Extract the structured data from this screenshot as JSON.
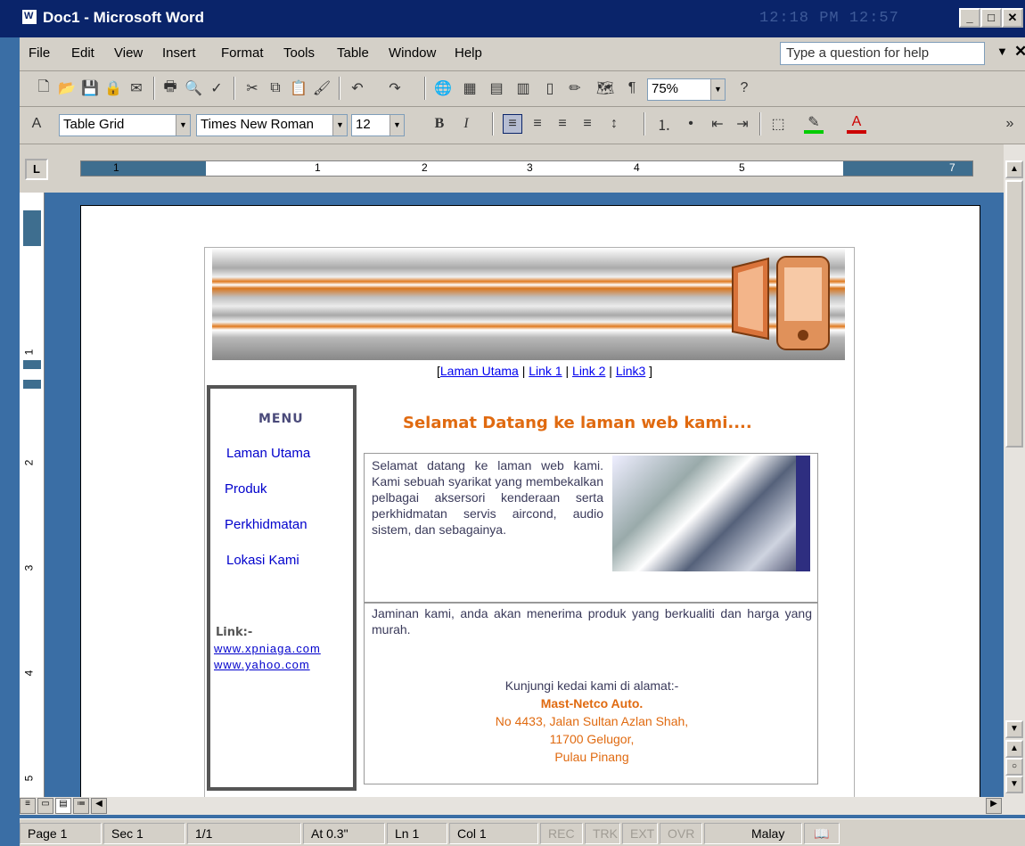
{
  "window": {
    "title": "Doc1 - Microsoft Word",
    "clock": "12:18 PM 12:57",
    "app_icon": "word-doc-icon",
    "controls": [
      "minimize-icon",
      "maximize-icon",
      "close-icon"
    ]
  },
  "menubar": {
    "items": [
      "File",
      "Edit",
      "View",
      "Insert",
      "Format",
      "Tools",
      "Table",
      "Window",
      "Help"
    ],
    "help_placeholder": "Type a question for help"
  },
  "toolbar_standard": {
    "zoom": "75%",
    "icons": [
      "new-icon",
      "open-icon",
      "save-icon",
      "permission-icon",
      "email-icon",
      "print-icon",
      "print-preview-icon",
      "spelling-icon",
      "cut-icon",
      "copy-icon",
      "paste-icon",
      "format-painter-icon",
      "undo-icon",
      "redo-icon",
      "hyperlink-icon",
      "tables-borders-icon",
      "insert-table-icon",
      "insert-excel-icon",
      "columns-icon",
      "drawing-icon",
      "document-map-icon",
      "show-hide-icon",
      "help-icon"
    ]
  },
  "toolbar_format": {
    "style": "Table Grid",
    "font": "Times New Roman",
    "size": "12",
    "bold": "B",
    "italic": "I"
  },
  "ruler": {
    "h_numbers": [
      "1",
      "1",
      "2",
      "3",
      "4",
      "5",
      "7"
    ],
    "v_numbers": [
      "1",
      "2",
      "3",
      "4",
      "5"
    ],
    "tab_selector": "L"
  },
  "statusbar": {
    "page": "Page 1",
    "sec": "Sec 1",
    "pages": "1/1",
    "at": "At 0.3\"",
    "ln": "Ln 1",
    "col": "Col 1",
    "rec": "REC",
    "trk": "TRK",
    "ext": "EXT",
    "ovr": "OVR",
    "lang": "Malay"
  },
  "webpage": {
    "top_links": [
      "Laman Utama",
      "Link 1",
      "Link 2",
      "Link3"
    ],
    "menu_title": "MENU",
    "menu_items": [
      "Laman Utama",
      "Produk",
      "Perkhidmatan",
      "Lokasi Kami"
    ],
    "link_label": "Link:-",
    "ext_links": [
      "www.xpniaga.com",
      "www.yahoo.com"
    ],
    "welcome": "Selamat Datang ke laman web kami....",
    "intro": "Selamat datang ke laman web kami. Kami sebuah syarikat yang membekalkan pelbagai aksersori kenderaan serta perkhidmatan servis aircond, audio sistem, dan sebagainya.",
    "promise": "Jaminan kami, anda akan menerima produk yang berkualiti dan harga yang murah.",
    "visit": "Kunjungi kedai kami di alamat:-",
    "address": [
      "Mast-Netco Auto.",
      "No 4433, Jalan Sultan Azlan Shah,",
      "11700 Gelugor,",
      "Pulau Pinang"
    ]
  }
}
